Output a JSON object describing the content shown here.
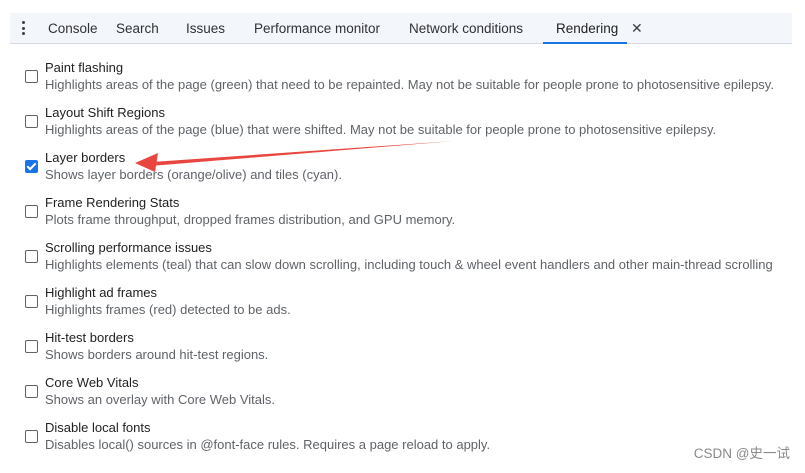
{
  "tabs": [
    {
      "label": "Console"
    },
    {
      "label": "Search"
    },
    {
      "label": "Issues"
    },
    {
      "label": "Performance monitor"
    },
    {
      "label": "Network conditions"
    },
    {
      "label": "Rendering"
    }
  ],
  "active_tab": "Rendering",
  "close_glyph": "✕",
  "settings": [
    {
      "title": "Paint flashing",
      "description": "Highlights areas of the page (green) that need to be repainted. May not be suitable for people prone to photosensitive epilepsy.",
      "checked": false
    },
    {
      "title": "Layout Shift Regions",
      "description": "Highlights areas of the page (blue) that were shifted. May not be suitable for people prone to photosensitive epilepsy.",
      "checked": false
    },
    {
      "title": "Layer borders",
      "description": "Shows layer borders (orange/olive) and tiles (cyan).",
      "checked": true
    },
    {
      "title": "Frame Rendering Stats",
      "description": "Plots frame throughput, dropped frames distribution, and GPU memory.",
      "checked": false
    },
    {
      "title": "Scrolling performance issues",
      "description": "Highlights elements (teal) that can slow down scrolling, including touch & wheel event handlers and other main-thread scrolling",
      "checked": false
    },
    {
      "title": "Highlight ad frames",
      "description": "Highlights frames (red) detected to be ads.",
      "checked": false
    },
    {
      "title": "Hit-test borders",
      "description": "Shows borders around hit-test regions.",
      "checked": false
    },
    {
      "title": "Core Web Vitals",
      "description": "Shows an overlay with Core Web Vitals.",
      "checked": false
    },
    {
      "title": "Disable local fonts",
      "description": "Disables local() sources in @font-face rules. Requires a page reload to apply.",
      "checked": false
    }
  ],
  "annotation_color": "#e8463f",
  "watermark": "CSDN @史一试"
}
